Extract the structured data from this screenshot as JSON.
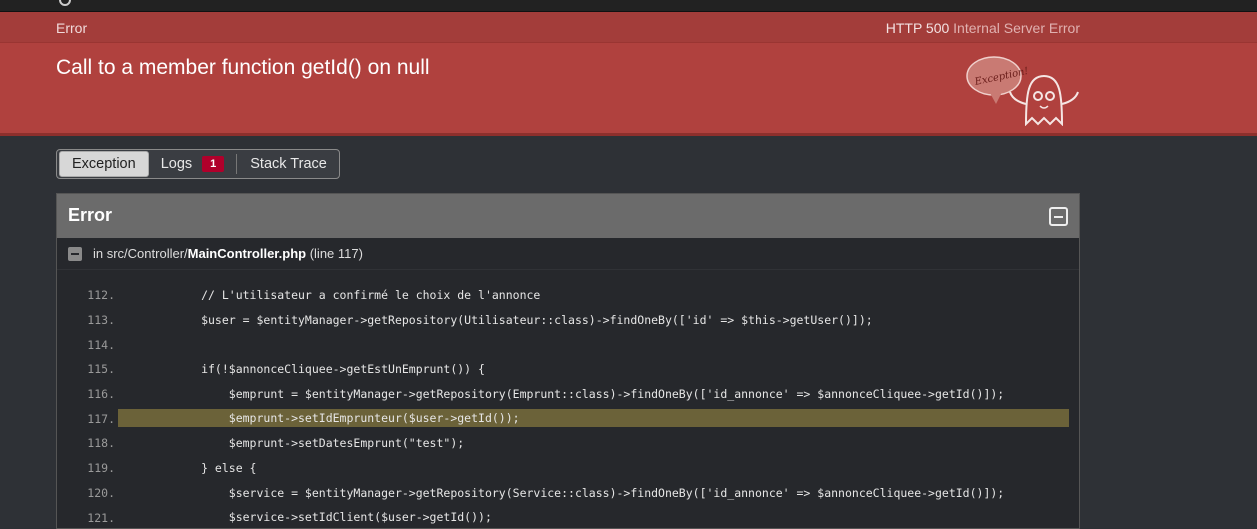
{
  "header": {
    "error_label": "Error",
    "status_code": "HTTP 500",
    "status_text": "Internal Server Error",
    "message": "Call to a member function getId() on null",
    "ghost_label": "Exception!"
  },
  "tabs": {
    "exception": "Exception",
    "logs": "Logs",
    "logs_count": "1",
    "stack_trace": "Stack Trace"
  },
  "panel": {
    "title": "Error",
    "file_prefix": "in src/Controller/",
    "file_name": "MainController.php",
    "file_suffix": "(line 117)"
  },
  "code": [
    {
      "ln": "112.",
      "src": "            // L'utilisateur a confirmé le choix de l'annonce",
      "hl": false
    },
    {
      "ln": "113.",
      "src": "            $user = $entityManager->getRepository(Utilisateur::class)->findOneBy(['id' => $this->getUser()]);",
      "hl": false
    },
    {
      "ln": "114.",
      "src": "",
      "hl": false
    },
    {
      "ln": "115.",
      "src": "            if(!$annonceCliquee->getEstUnEmprunt()) {",
      "hl": false
    },
    {
      "ln": "116.",
      "src": "                $emprunt = $entityManager->getRepository(Emprunt::class)->findOneBy(['id_annonce' => $annonceCliquee->getId()]);",
      "hl": false
    },
    {
      "ln": "117.",
      "src": "                $emprunt->setIdEmprunteur($user->getId());",
      "hl": true
    },
    {
      "ln": "118.",
      "src": "                $emprunt->setDatesEmprunt(\"test\");",
      "hl": false
    },
    {
      "ln": "119.",
      "src": "            } else {",
      "hl": false
    },
    {
      "ln": "120.",
      "src": "                $service = $entityManager->getRepository(Service::class)->findOneBy(['id_annonce' => $annonceCliquee->getId()]);",
      "hl": false
    },
    {
      "ln": "121.",
      "src": "                $service->setIdClient($user->getId());",
      "hl": false
    }
  ],
  "colors": {
    "header_bg": "#b0413e",
    "highlight": "#6b6239",
    "badge": "#b0002b"
  }
}
